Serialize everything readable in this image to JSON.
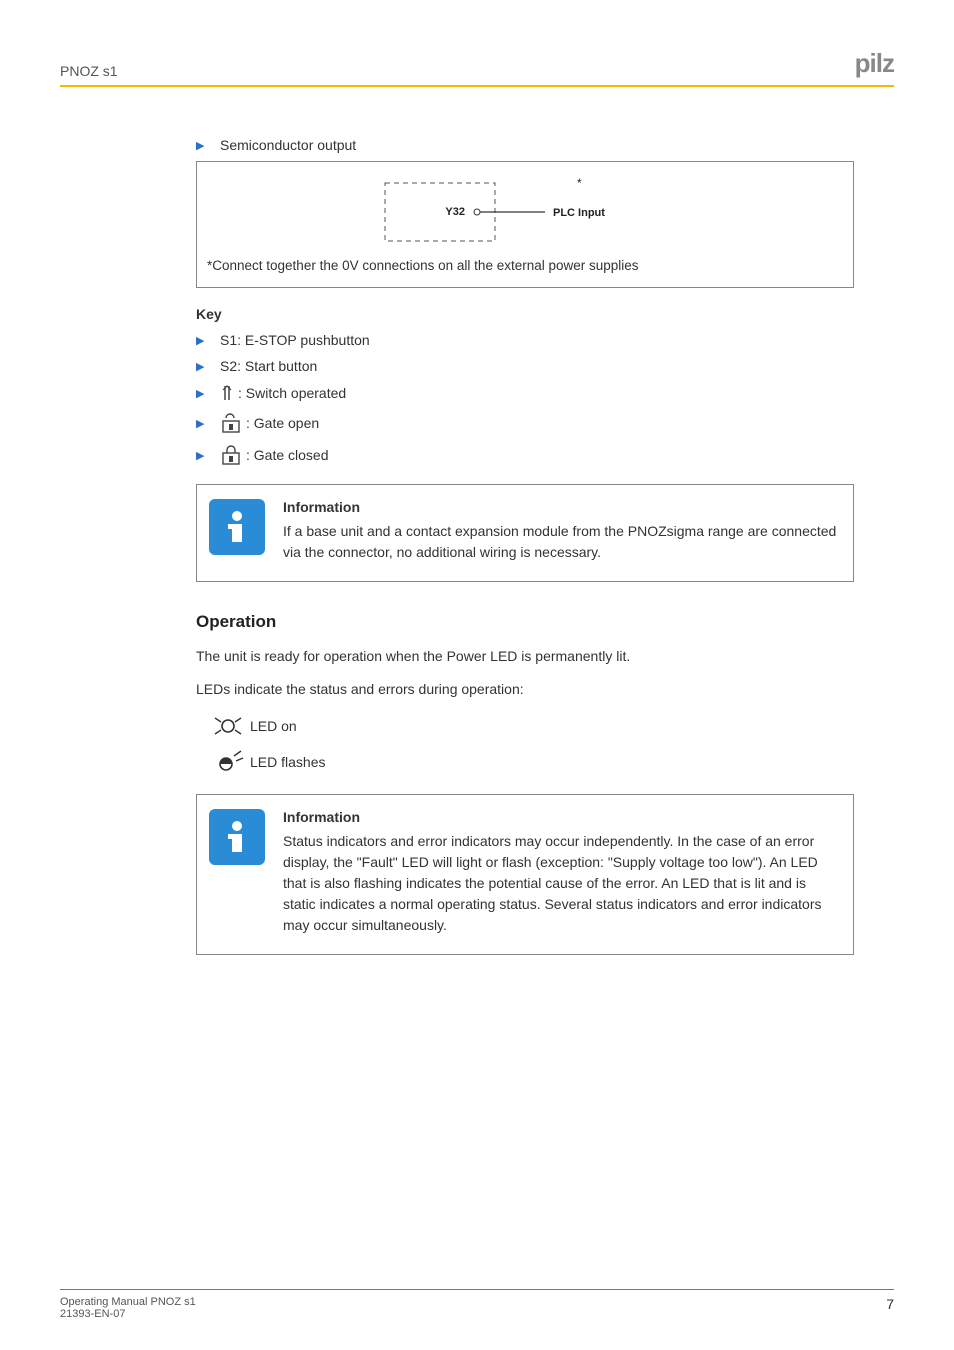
{
  "header": {
    "doc_title_short": "PNOZ s1",
    "logo_text": "pilz"
  },
  "semiconductor": {
    "label": "Semiconductor output",
    "diagram": {
      "y32": "Y32",
      "plc_input": "PLC Input",
      "star": "*"
    },
    "footnote": "*Connect together the 0V connections on all the external power supplies"
  },
  "key": {
    "title": "Key",
    "items": {
      "s1": "S1: E-STOP pushbutton",
      "s2": "S2: Start button",
      "switch_operated": ": Switch operated",
      "gate_open": ": Gate open",
      "gate_closed": ": Gate closed"
    }
  },
  "info1": {
    "title": "Information",
    "text": "If a base unit and a contact expansion module from the PNOZsigma range are connected via the connector, no additional wiring is necessary."
  },
  "operation": {
    "heading": "Operation",
    "para1": "The unit is ready for operation when the Power LED is permanently lit.",
    "para2": "LEDs indicate the status and errors during operation:",
    "led_on": "LED on",
    "led_flashes": "LED flashes"
  },
  "info2": {
    "title": "Information",
    "text": "Status indicators and error indicators may occur independently. In the case of an error display, the \"Fault\" LED will light or flash (exception: \"Supply voltage too low\"). An LED that is also flashing indicates the potential cause of the error. An LED that is lit and is static indicates a normal operating status. Several status indicators and error indicators may occur simultaneously."
  },
  "footer": {
    "line1": "Operating Manual PNOZ s1",
    "line2": "21393-EN-07",
    "page": "7"
  }
}
